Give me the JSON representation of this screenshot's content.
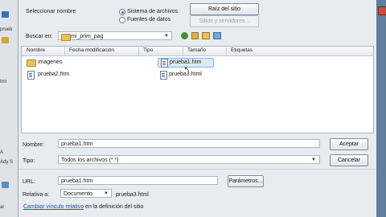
{
  "background": {
    "left_words": [
      "prueb",
      "tml",
      "A",
      "Ady S",
      "ar"
    ],
    "right_close": "x"
  },
  "dialog": {
    "select_name_label": "Seleccionar nombre",
    "radio_filesystem": "Sistema de archivos",
    "radio_datasources": "Fuentes de datos",
    "site_root_button": "Raíz del sitio",
    "servers_button": "Sitios y servidores...",
    "search_in_label": "Buscar en:",
    "search_in_value": "mi_prim_pag",
    "columns": [
      "Nombre",
      "Fecha modificación",
      "Tipo",
      "Tamaño",
      "Etiquetas"
    ],
    "files": [
      {
        "name": "imagenes",
        "kind": "folder"
      },
      {
        "name": "prueba1.htm",
        "kind": "file",
        "selected": true
      },
      {
        "name": "prueba2.htm",
        "kind": "file"
      },
      {
        "name": "prueba3.html",
        "kind": "file"
      }
    ],
    "name_label": "Nombre:",
    "name_value": "prueba1.htm",
    "accept_button": "Aceptar",
    "type_label": "Tipo:",
    "type_value": "Todos los archivos (*.*)",
    "cancel_button": "Cancelar",
    "url_label": "URL:",
    "url_value": "prueba1.htm",
    "params_button": "Parámetros...",
    "relative_label": "Relativa a:",
    "relative_value": "Documento",
    "relative_file": "prueba3.html",
    "change_link": "Cambiar vínculo relativo",
    "change_rest": "en la definición del sitio"
  }
}
